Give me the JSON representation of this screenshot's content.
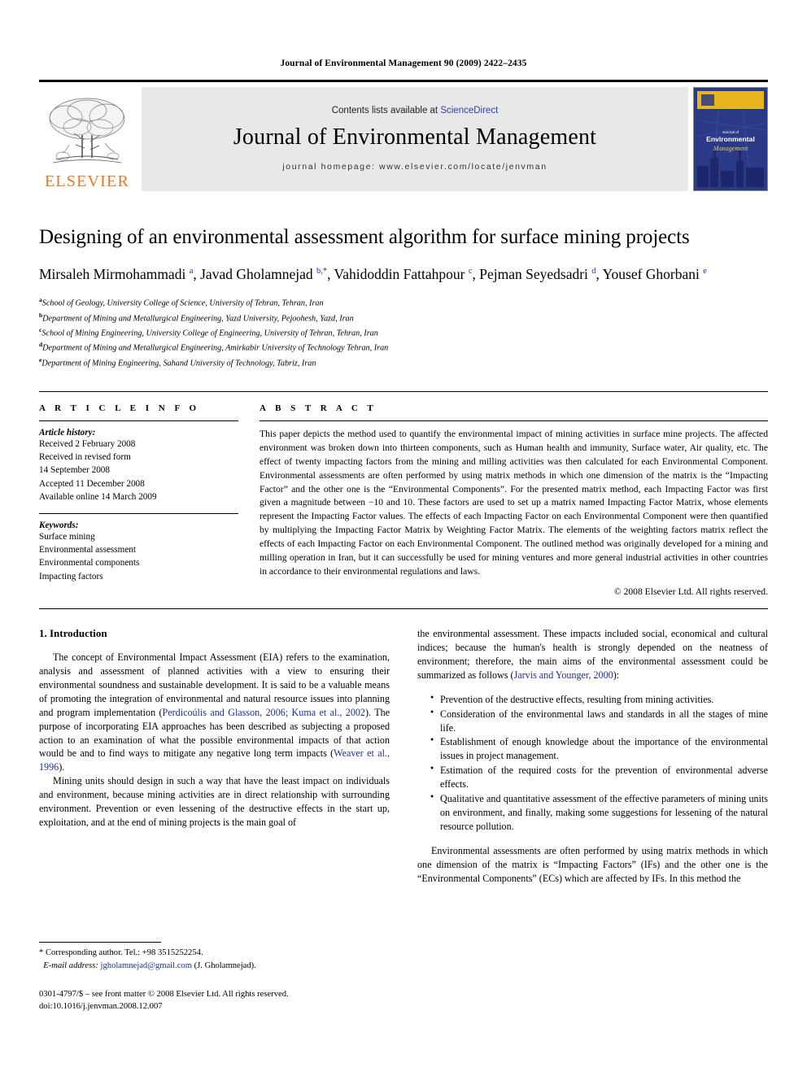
{
  "running_head": "Journal of Environmental Management 90 (2009) 2422–2435",
  "masthead": {
    "publisher_wordmark": "ELSEVIER",
    "contents_prefix": "Contents lists available at ",
    "contents_link": "ScienceDirect",
    "journal_title": "Journal of Environmental Management",
    "homepage_label": "journal homepage: www.elsevier.com/locate/jenvman",
    "cover": {
      "kicker": "Journal of",
      "line1": "Environmental",
      "line2": "Management"
    }
  },
  "article": {
    "title": "Designing of an environmental assessment algorithm for surface mining projects",
    "authors_html": "Mirsaleh Mirmohammadi <sup>a</sup>, Javad Gholamnejad <sup>b,*</sup>, Vahidoddin Fattahpour <sup>c</sup>, Pejman Seyedsadri <sup>d</sup>, Yousef Ghorbani <sup>e</sup>",
    "affiliations": [
      {
        "mark": "a",
        "text": "School of Geology, University College of Science, University of Tehran, Tehran, Iran"
      },
      {
        "mark": "b",
        "text": "Department of Mining and Metallurgical Engineering, Yazd University, Pejoohesh, Yazd, Iran"
      },
      {
        "mark": "c",
        "text": "School of Mining Engineering, University College of Engineering, University of Tehran, Tehran, Iran"
      },
      {
        "mark": "d",
        "text": "Department of Mining and Metallurgical Engineering, Amirkabir University of Technology Tehran, Iran"
      },
      {
        "mark": "e",
        "text": "Department of Mining Engineering, Sahand University of Technology, Tabriz, Iran"
      }
    ]
  },
  "article_info": {
    "heading": "A R T I C L E  I N F O",
    "history_label": "Article history:",
    "history": [
      "Received 2 February 2008",
      "Received in revised form",
      "14 September 2008",
      "Accepted 11 December 2008",
      "Available online 14 March 2009"
    ],
    "keywords_label": "Keywords:",
    "keywords": [
      "Surface mining",
      "Environmental assessment",
      "Environmental components",
      "Impacting factors"
    ]
  },
  "abstract": {
    "heading": "A B S T R A C T",
    "text": "This paper depicts the method used to quantify the environmental impact of mining activities in surface mine projects. The affected environment was broken down into thirteen components, such as Human health and immunity, Surface water, Air quality, etc. The effect of twenty impacting factors from the mining and milling activities was then calculated for each Environmental Component. Environmental assessments are often performed by using matrix methods in which one dimension of the matrix is the “Impacting Factor” and the other one is the “Environmental Components”. For the presented matrix method, each Impacting Factor was first given a magnitude between −10 and 10. These factors are used to set up a matrix named Impacting Factor Matrix, whose elements represent the Impacting Factor values. The effects of each Impacting Factor on each Environmental Component were then quantified by multiplying the Impacting Factor Matrix by Weighting Factor Matrix. The elements of the weighting factors matrix reflect the effects of each Impacting Factor on each Environmental Component. The outlined method was originally developed for a mining and milling operation in Iran, but it can successfully be used for mining ventures and more general industrial activities in other countries in accordance to their environmental regulations and laws.",
    "copyright": "© 2008 Elsevier Ltd. All rights reserved."
  },
  "introduction": {
    "heading": "1.  Introduction",
    "para1_a": "The concept of Environmental Impact Assessment (EIA) refers to the examination, analysis and assessment of planned activities with a view to ensuring their environmental soundness and sustainable development. It is said to be a valuable means of promoting the integration of environmental and natural resource issues into planning and program implementation (",
    "para1_cite": "Perdicoúlis and Glasson, 2006; Kuma et al., 2002",
    "para1_b": "). The purpose of incorporating EIA approaches has been described as subjecting a proposed action to an examination of what the possible environmental impacts of that action would be and to find ways to mitigate any negative long term impacts (",
    "para1_cite2": "Weaver et al., 1996",
    "para1_c": ").",
    "para2": "Mining units should design in such a way that have the least impact on individuals and environment, because mining activities are in direct relationship with surrounding environment. Prevention or even lessening of the destructive effects in the start up, exploitation, and at the end of mining projects is the main goal of",
    "para3_a": "the environmental assessment. These impacts included social, economical and cultural indices; because the human's health is strongly depended on the neatness of environment; therefore, the main aims of the environmental assessment could be summarized as follows (",
    "para3_cite": "Jarvis and Younger, 2000",
    "para3_b": "):",
    "aims": [
      "Prevention of the destructive effects, resulting from mining activities.",
      "Consideration of the environmental laws and standards in all the stages of mine life.",
      "Establishment of enough knowledge about the importance of the environmental issues in project management.",
      "Estimation of the required costs for the prevention of environmental adverse effects.",
      "Qualitative and quantitative assessment of the effective parameters of mining units on environment, and finally, making some suggestions for lessening of the natural resource pollution."
    ],
    "para4": "Environmental assessments are often performed by using matrix methods in which one dimension of the matrix is “Impacting Factors” (IFs) and the other one is the “Environmental Components” (ECs) which are affected by IFs. In this method the"
  },
  "footnote": {
    "corresponding": "* Corresponding author. Tel.: +98 3515252254.",
    "email_label": "E-mail address:",
    "email": "jgholamnejad@gmail.com",
    "email_suffix": " (J. Gholamnejad)."
  },
  "imprint": {
    "line1": "0301-4797/$ – see front matter © 2008 Elsevier Ltd. All rights reserved.",
    "line2": "doi:10.1016/j.jenvman.2008.12.007"
  },
  "colors": {
    "elsevier_orange": "#E87722",
    "link_blue": "#1f2f8f",
    "sciencedirect_blue": "#2a3fb0",
    "band_gray": "#e8e8e8",
    "cover_navy": "#2a3a86",
    "cover_gold": "#e8b51e"
  }
}
